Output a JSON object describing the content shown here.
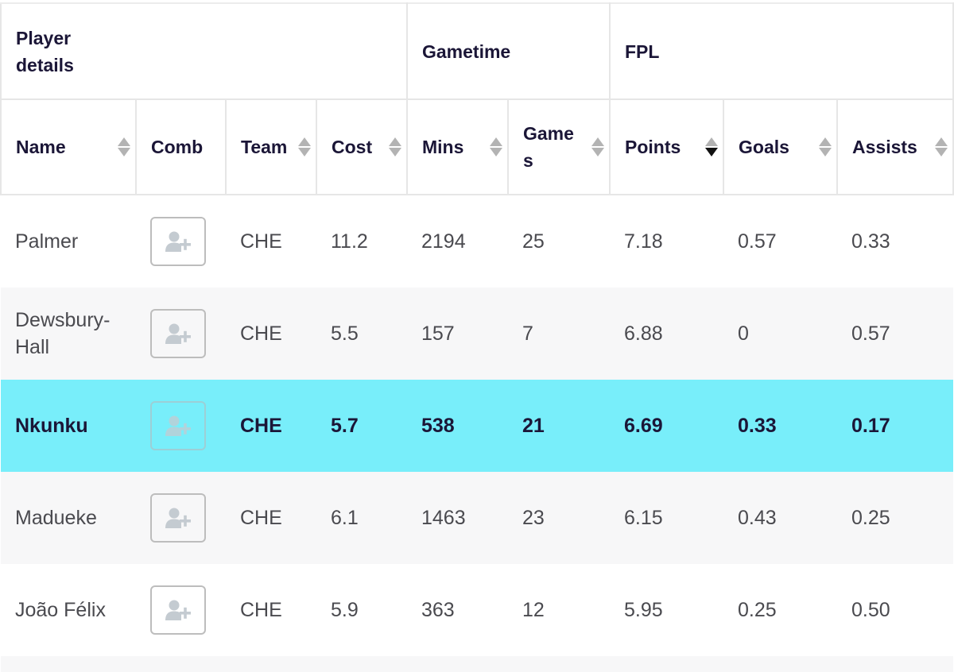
{
  "column_groups": [
    {
      "label": "Player details"
    },
    {
      "label": "Gametime"
    },
    {
      "label": "FPL"
    }
  ],
  "columns": [
    {
      "key": "name",
      "label": "Name",
      "sortable": true,
      "sort": "none"
    },
    {
      "key": "comb",
      "label": "Comb",
      "sortable": false
    },
    {
      "key": "team",
      "label": "Team",
      "sortable": true,
      "sort": "none"
    },
    {
      "key": "cost",
      "label": "Cost",
      "sortable": true,
      "sort": "none"
    },
    {
      "key": "mins",
      "label": "Mins",
      "sortable": true,
      "sort": "none"
    },
    {
      "key": "games",
      "label": "Games",
      "sortable": true,
      "sort": "none"
    },
    {
      "key": "points",
      "label": "Points",
      "sortable": true,
      "sort": "descending"
    },
    {
      "key": "goals",
      "label": "Goals",
      "sortable": true,
      "sort": "none"
    },
    {
      "key": "assists",
      "label": "Assists",
      "sortable": true,
      "sort": "none"
    }
  ],
  "icons": {
    "comb_button": "add-user-icon",
    "sort": "sort-up-down-icon"
  },
  "colors": {
    "highlight_row": "#78eefa",
    "alt_row": "#f7f7f8",
    "header_text": "#1b1637",
    "body_text": "#4a4a4f",
    "sort_inactive": "#b3b3b3",
    "sort_active": "#111111"
  },
  "rows": [
    {
      "name": "Palmer",
      "team": "CHE",
      "cost": "11.2",
      "mins": "2194",
      "games": "25",
      "points": "7.18",
      "goals": "0.57",
      "assists": "0.33",
      "highlighted": false
    },
    {
      "name": "Dewsbury-Hall",
      "team": "CHE",
      "cost": "5.5",
      "mins": "157",
      "games": "7",
      "points": "6.88",
      "goals": "0",
      "assists": "0.57",
      "highlighted": false
    },
    {
      "name": "Nkunku",
      "team": "CHE",
      "cost": "5.7",
      "mins": "538",
      "games": "21",
      "points": "6.69",
      "goals": "0.33",
      "assists": "0.17",
      "highlighted": true
    },
    {
      "name": "Madueke",
      "team": "CHE",
      "cost": "6.1",
      "mins": "1463",
      "games": "23",
      "points": "6.15",
      "goals": "0.43",
      "assists": "0.25",
      "highlighted": false
    },
    {
      "name": "João Félix",
      "team": "CHE",
      "cost": "5.9",
      "mins": "363",
      "games": "12",
      "points": "5.95",
      "goals": "0.25",
      "assists": "0.50",
      "highlighted": false
    }
  ]
}
